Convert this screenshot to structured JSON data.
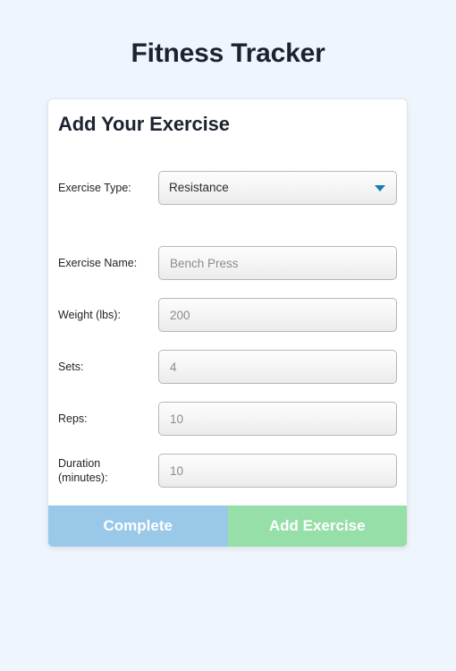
{
  "app": {
    "title": "Fitness Tracker",
    "background_color": "#eff5fd",
    "title_color": "#1b2330"
  },
  "card": {
    "heading": "Add Your Exercise"
  },
  "form": {
    "exercise_type": {
      "label": "Exercise Type:",
      "value": "Resistance",
      "arrow_color": "#1a7cb5"
    },
    "exercise_name": {
      "label": "Exercise Name:",
      "placeholder": "Bench Press",
      "value": ""
    },
    "weight": {
      "label": "Weight (lbs):",
      "placeholder": "200",
      "value": ""
    },
    "sets": {
      "label": "Sets:",
      "placeholder": "4",
      "value": ""
    },
    "reps": {
      "label": "Reps:",
      "placeholder": "10",
      "value": ""
    },
    "duration": {
      "label": "Duration (minutes):",
      "placeholder": "10",
      "value": ""
    }
  },
  "actions": {
    "complete_label": "Complete",
    "complete_color": "#9ac8e8",
    "add_label": "Add Exercise",
    "add_color": "#97dfa8"
  }
}
